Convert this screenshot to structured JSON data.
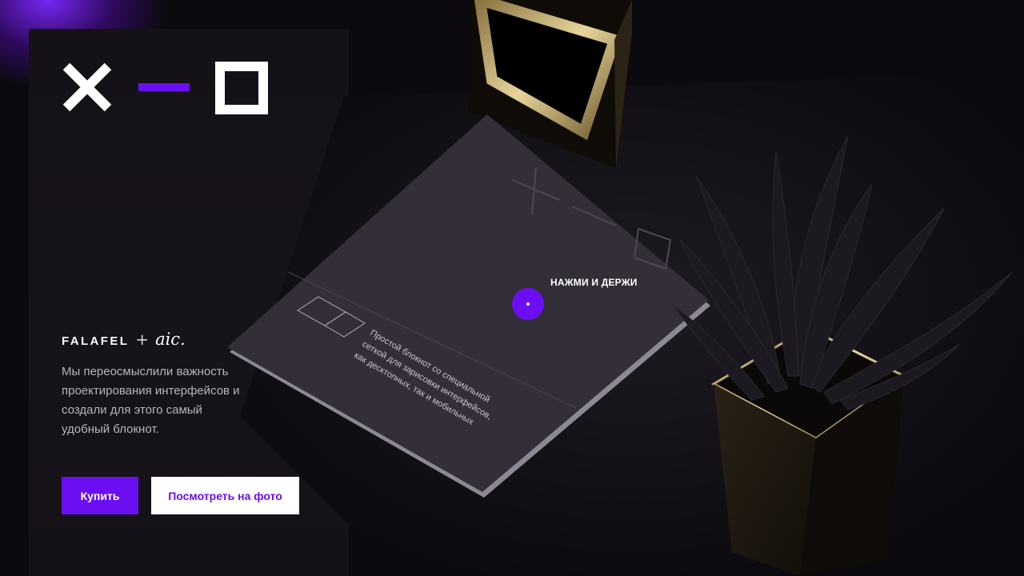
{
  "brand": {
    "name": "FALAFEL",
    "plus": "+",
    "partner": "aic.",
    "logo_icons": [
      "cross-icon",
      "minus-icon",
      "square-icon"
    ],
    "accent_color": "#6b0ff2"
  },
  "description": "Мы переосмыслили важность проектирования интерфейсов и создали для этого самый удобный блокнот.",
  "buttons": {
    "buy": "Купить",
    "photo": "Посмотреть на фото"
  },
  "hotspot": {
    "label": "НАЖМИ И ДЕРЖИ"
  },
  "notebook": {
    "cover_text": "Простой блокнот со специальной сеткой для зарисовки интерфейсов, как десктопных, так и мобильных"
  }
}
